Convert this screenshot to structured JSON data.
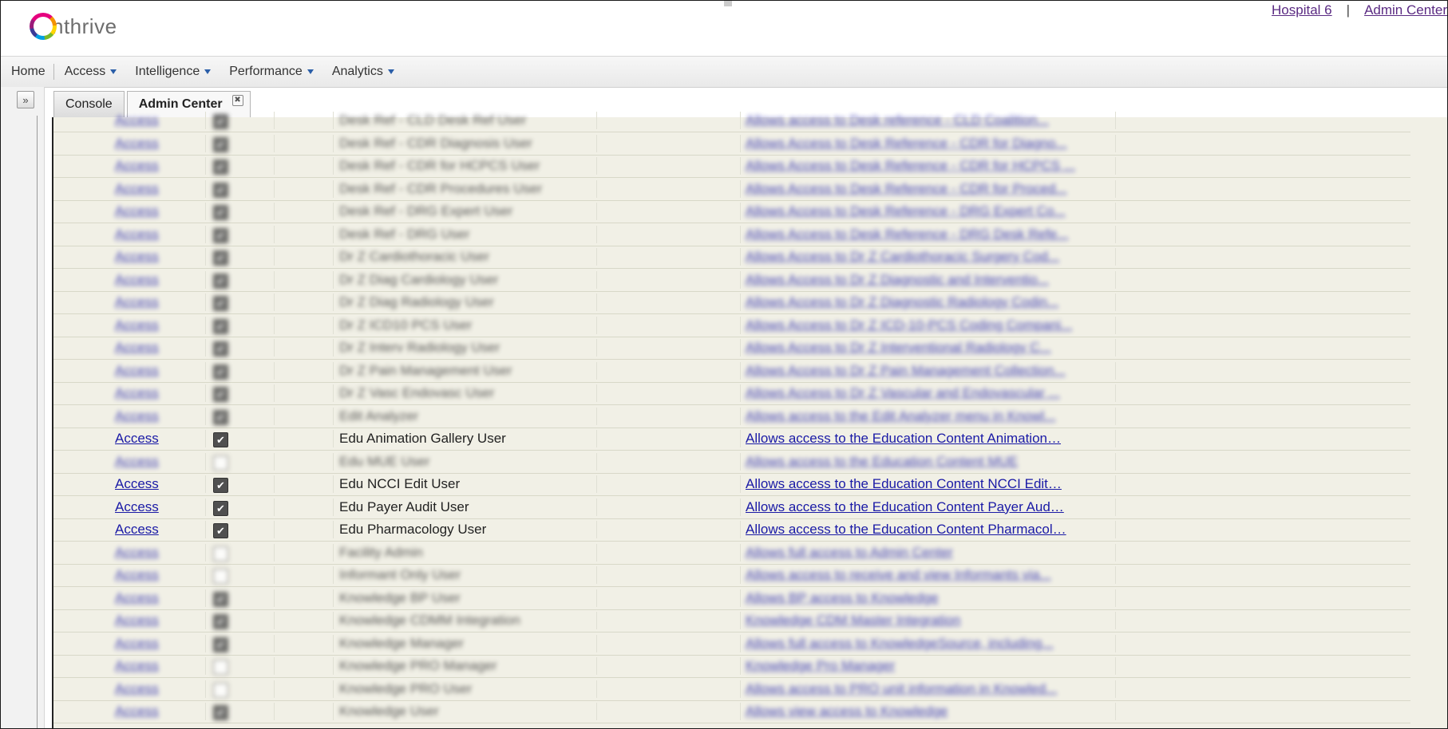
{
  "header": {
    "logo_text": "nthrive",
    "logo_letter": "n",
    "links": [
      "Hospital 6",
      "Admin Center"
    ],
    "separator": "|"
  },
  "nav": {
    "items": [
      {
        "label": "Home",
        "dropdown": false
      },
      {
        "label": "Access",
        "dropdown": true
      },
      {
        "label": "Intelligence",
        "dropdown": true
      },
      {
        "label": "Performance",
        "dropdown": true
      },
      {
        "label": "Analytics",
        "dropdown": true
      }
    ]
  },
  "left_rail": {
    "expand_glyph": "»"
  },
  "tabs": [
    {
      "label": "Console",
      "active": false
    },
    {
      "label": "Admin Center",
      "active": true,
      "close_glyph": "✖"
    }
  ],
  "table": {
    "rows": [
      {
        "action": "Access",
        "checked": true,
        "role": "Desk Ref - CLD Desk Ref User",
        "description": "Allows access to Desk reference - CLD Coalition...",
        "blurred": true
      },
      {
        "action": "Access",
        "checked": true,
        "role": "Desk Ref - CDR Diagnosis User",
        "description": "Allows Access to Desk Reference - CDR for Diagno...",
        "blurred": true
      },
      {
        "action": "Access",
        "checked": true,
        "role": "Desk Ref - CDR for HCPCS User",
        "description": "Allows Access to Desk Reference - CDR for HCPCS ...",
        "blurred": true
      },
      {
        "action": "Access",
        "checked": true,
        "role": "Desk Ref - CDR Procedures User",
        "description": "Allows Access to Desk Reference - CDR for Proced...",
        "blurred": true
      },
      {
        "action": "Access",
        "checked": true,
        "role": "Desk Ref - DRG Expert User",
        "description": "Allows Access to Desk Reference - DRG Expert Co...",
        "blurred": true
      },
      {
        "action": "Access",
        "checked": true,
        "role": "Desk Ref - DRG User",
        "description": "Allows Access to Desk Reference - DRG Desk Refe...",
        "blurred": true
      },
      {
        "action": "Access",
        "checked": true,
        "role": "Dr Z Cardiothoracic User",
        "description": "Allows Access to Dr Z Cardiothoracic Surgery Cod...",
        "blurred": true
      },
      {
        "action": "Access",
        "checked": true,
        "role": "Dr Z Diag Cardiology User",
        "description": "Allows Access to Dr Z Diagnostic and Interventio...",
        "blurred": true
      },
      {
        "action": "Access",
        "checked": true,
        "role": "Dr Z Diag Radiology User",
        "description": "Allows Access to Dr Z Diagnostic Radiology Codin...",
        "blurred": true
      },
      {
        "action": "Access",
        "checked": true,
        "role": "Dr Z ICD10 PCS User",
        "description": "Allows Access to Dr Z ICD-10-PCS Coding Compani...",
        "blurred": true
      },
      {
        "action": "Access",
        "checked": true,
        "role": "Dr Z Interv Radiology User",
        "description": "Allows Access to Dr Z Interventional Radiology C...",
        "blurred": true
      },
      {
        "action": "Access",
        "checked": true,
        "role": "Dr Z Pain Management User",
        "description": "Allows Access to Dr Z Pain Management Collection...",
        "blurred": true
      },
      {
        "action": "Access",
        "checked": true,
        "role": "Dr Z Vasc Endovasc User",
        "description": "Allows Access to Dr Z Vascular and Endovascular ...",
        "blurred": true
      },
      {
        "action": "Access",
        "checked": true,
        "role": "Edit Analyzer",
        "description": "Allows access to the Edit Analyzer menu in Knowl...",
        "blurred": true
      },
      {
        "action": "Access",
        "checked": true,
        "role": "Edu Animation Gallery User",
        "description": "Allows access to the Education Content Animation…",
        "blurred": false
      },
      {
        "action": "Access",
        "checked": false,
        "role": "Edu MUE User",
        "description": "Allows access to the Education Content MUE",
        "blurred": true
      },
      {
        "action": "Access",
        "checked": true,
        "role": "Edu NCCI Edit User",
        "description": "Allows access to the Education Content NCCI Edit…",
        "blurred": false
      },
      {
        "action": "Access",
        "checked": true,
        "role": "Edu Payer Audit User",
        "description": "Allows access to the Education Content Payer Aud…",
        "blurred": false
      },
      {
        "action": "Access",
        "checked": true,
        "role": "Edu Pharmacology User",
        "description": "Allows access to the Education Content Pharmacol…",
        "blurred": false
      },
      {
        "action": "Access",
        "checked": false,
        "role": "Facility Admin",
        "description": "Allows full access to Admin Center",
        "blurred": true
      },
      {
        "action": "Access",
        "checked": false,
        "role": "Informant Only User",
        "description": "Allows access to receive and view Informants via...",
        "blurred": true
      },
      {
        "action": "Access",
        "checked": true,
        "role": "Knowledge BP User",
        "description": "Allows BP access to Knowledge",
        "blurred": true
      },
      {
        "action": "Access",
        "checked": true,
        "role": "Knowledge CDMM Integration",
        "description": "Knowledge CDM Master Integration",
        "blurred": true
      },
      {
        "action": "Access",
        "checked": true,
        "role": "Knowledge Manager",
        "description": "Allows full access to KnowledgeSource, including...",
        "blurred": true
      },
      {
        "action": "Access",
        "checked": false,
        "role": "Knowledge PRO Manager",
        "description": "Knowledge Pro Manager",
        "blurred": true
      },
      {
        "action": "Access",
        "checked": false,
        "role": "Knowledge PRO User",
        "description": "Allows access to PRO unit information in Knowled...",
        "blurred": true
      },
      {
        "action": "Access",
        "checked": true,
        "role": "Knowledge User",
        "description": "Allows view access to Knowledge",
        "blurred": true
      }
    ]
  },
  "colors": {
    "content_bg": "#f1f0e6",
    "link": "#1a1aa6",
    "header_link": "#5a2a82",
    "nav_caret": "#2a5ea8"
  }
}
